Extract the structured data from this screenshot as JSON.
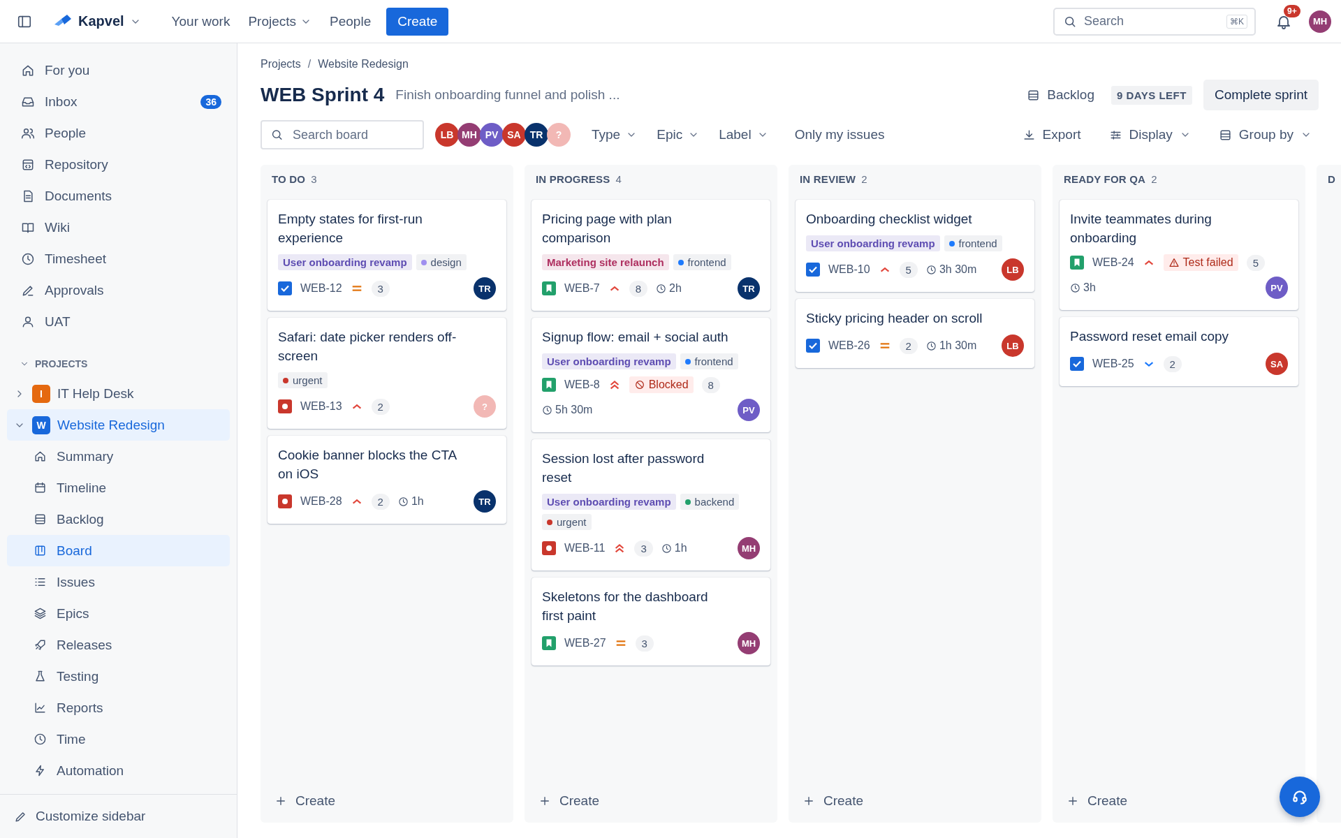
{
  "topbar": {
    "brand": "Kapvel",
    "nav": [
      {
        "label": "Your work",
        "dropdown": false
      },
      {
        "label": "Projects",
        "dropdown": true
      },
      {
        "label": "People",
        "dropdown": false
      }
    ],
    "create": "Create",
    "search": {
      "placeholder": "Search",
      "shortcut": "⌘K"
    },
    "notifications": "9+",
    "avatar": {
      "initials": "MH",
      "color": "#943d73"
    }
  },
  "sidebar": {
    "items": [
      {
        "label": "For you"
      },
      {
        "label": "Inbox",
        "badge": "36"
      },
      {
        "label": "People"
      },
      {
        "label": "Repository"
      },
      {
        "label": "Documents"
      },
      {
        "label": "Wiki"
      },
      {
        "label": "Timesheet"
      },
      {
        "label": "Approvals"
      },
      {
        "label": "UAT"
      }
    ],
    "projects_heading": "PROJECTS",
    "projects": [
      {
        "label": "IT Help Desk",
        "letter": "I",
        "color": "#e56910",
        "expanded": false,
        "selected": false
      },
      {
        "label": "Website Redesign",
        "letter": "W",
        "color": "#1868db",
        "expanded": true,
        "selected": true,
        "children": [
          {
            "label": "Summary",
            "selected": false
          },
          {
            "label": "Timeline",
            "selected": false
          },
          {
            "label": "Backlog",
            "selected": false
          },
          {
            "label": "Board",
            "selected": true
          },
          {
            "label": "Issues",
            "selected": false
          },
          {
            "label": "Epics",
            "selected": false
          },
          {
            "label": "Releases",
            "selected": false
          },
          {
            "label": "Testing",
            "selected": false
          },
          {
            "label": "Reports",
            "selected": false
          },
          {
            "label": "Time",
            "selected": false
          },
          {
            "label": "Automation",
            "selected": false
          }
        ]
      }
    ],
    "customize": "Customize sidebar"
  },
  "header": {
    "breadcrumbs": [
      "Projects",
      "Website Redesign"
    ],
    "separator": "/",
    "title": "WEB Sprint 4",
    "goal": "Finish onboarding funnel and polish ...",
    "backlog": "Backlog",
    "days_left": "9 DAYS LEFT",
    "complete": "Complete sprint"
  },
  "toolbar": {
    "search": {
      "placeholder": "Search board"
    },
    "avatars": [
      {
        "initials": "LB",
        "color": "#c9372c"
      },
      {
        "initials": "MH",
        "color": "#943d73"
      },
      {
        "initials": "PV",
        "color": "#6e5dc6"
      },
      {
        "initials": "SA",
        "color": "#c9372c"
      },
      {
        "initials": "TR",
        "color": "#09326c"
      },
      {
        "initials": "?",
        "color": "#f2b8b5"
      }
    ],
    "filters": [
      {
        "label": "Type"
      },
      {
        "label": "Epic"
      },
      {
        "label": "Label"
      }
    ],
    "only_mine": "Only my issues",
    "actions": [
      {
        "label": "Export",
        "dropdown": false
      },
      {
        "label": "Display",
        "dropdown": true
      },
      {
        "label": "Group by",
        "dropdown": true
      }
    ]
  },
  "columns": [
    {
      "name": "TO DO",
      "count": "3",
      "create": "Create",
      "cards": [
        {
          "title": "Empty states for first-run experience",
          "tags": [
            {
              "kind": "epic",
              "text": "User onboarding revamp",
              "color": "#5e4db2"
            },
            {
              "kind": "label",
              "text": "design",
              "color": "#9f8fef"
            }
          ],
          "kind": "task",
          "key": "WEB-12",
          "priority": {
            "kind": "medium"
          },
          "points": "3",
          "assignee": {
            "initials": "TR",
            "color": "#09326c"
          }
        },
        {
          "title": "Safari: date picker renders off-screen",
          "tags": [
            {
              "kind": "label",
              "text": "urgent",
              "color": "#c9372c"
            }
          ],
          "kind": "bug",
          "key": "WEB-13",
          "priority": {
            "kind": "high"
          },
          "points": "2",
          "assignee": {
            "initials": "?",
            "color": "#f2b8b5"
          }
        },
        {
          "title": "Cookie banner blocks the CTA on iOS",
          "kind": "bug",
          "key": "WEB-28",
          "priority": {
            "kind": "high"
          },
          "points": "2",
          "time": "1h",
          "assignee": {
            "initials": "TR",
            "color": "#09326c"
          }
        }
      ]
    },
    {
      "name": "IN PROGRESS",
      "count": "4",
      "create": "Create",
      "cards": [
        {
          "title": "Pricing page with plan comparison",
          "tags": [
            {
              "kind": "epic",
              "text": "Marketing site relaunch",
              "color": "#ae2e5f"
            },
            {
              "kind": "label",
              "text": "frontend",
              "color": "#1d7afc"
            }
          ],
          "kind": "story",
          "key": "WEB-7",
          "priority": {
            "kind": "high"
          },
          "points": "8",
          "time": "2h",
          "assignee": {
            "initials": "TR",
            "color": "#09326c"
          }
        },
        {
          "title": "Signup flow: email + social auth",
          "tags": [
            {
              "kind": "epic",
              "text": "User onboarding revamp",
              "color": "#5e4db2"
            },
            {
              "kind": "label",
              "text": "frontend",
              "color": "#1d7afc"
            }
          ],
          "kind": "story",
          "key": "WEB-8",
          "priority": {
            "kind": "highest"
          },
          "flag": {
            "kind": "blocked",
            "text": "Blocked"
          },
          "points": "8",
          "time": "5h 30m",
          "assignee": {
            "initials": "PV",
            "color": "#6e5dc6"
          }
        },
        {
          "title": "Session lost after password reset",
          "tags": [
            {
              "kind": "epic",
              "text": "User onboarding revamp",
              "color": "#5e4db2"
            },
            {
              "kind": "label",
              "text": "backend",
              "color": "#22a06b"
            },
            {
              "kind": "label",
              "text": "urgent",
              "color": "#c9372c"
            }
          ],
          "kind": "bug",
          "key": "WEB-11",
          "priority": {
            "kind": "highest"
          },
          "points": "3",
          "time": "1h",
          "assignee": {
            "initials": "MH",
            "color": "#943d73"
          }
        },
        {
          "title": "Skeletons for the dashboard first paint",
          "kind": "story",
          "key": "WEB-27",
          "priority": {
            "kind": "medium"
          },
          "points": "3",
          "assignee": {
            "initials": "MH",
            "color": "#943d73"
          }
        }
      ]
    },
    {
      "name": "IN REVIEW",
      "count": "2",
      "create": "Create",
      "cards": [
        {
          "title": "Onboarding checklist widget",
          "tags": [
            {
              "kind": "epic",
              "text": "User onboarding revamp",
              "color": "#5e4db2"
            },
            {
              "kind": "label",
              "text": "frontend",
              "color": "#1d7afc"
            }
          ],
          "kind": "task",
          "key": "WEB-10",
          "priority": {
            "kind": "high"
          },
          "points": "5",
          "time": "3h 30m",
          "assignee": {
            "initials": "LB",
            "color": "#c9372c"
          }
        },
        {
          "title": "Sticky pricing header on scroll",
          "kind": "task",
          "key": "WEB-26",
          "priority": {
            "kind": "medium"
          },
          "points": "2",
          "time": "1h 30m",
          "assignee": {
            "initials": "LB",
            "color": "#c9372c"
          }
        }
      ]
    },
    {
      "name": "READY FOR QA",
      "count": "2",
      "create": "Create",
      "cards": [
        {
          "title": "Invite teammates during onboarding",
          "kind": "story",
          "key": "WEB-24",
          "priority": {
            "kind": "high"
          },
          "flag": {
            "kind": "failed",
            "text": "Test failed"
          },
          "points": "5",
          "time": "3h",
          "assignee": {
            "initials": "PV",
            "color": "#6e5dc6"
          }
        },
        {
          "title": "Password reset email copy",
          "kind": "task",
          "key": "WEB-25",
          "priority": {
            "kind": "low"
          },
          "points": "2",
          "assignee": {
            "initials": "SA",
            "color": "#c9372c"
          }
        }
      ]
    },
    {
      "name": "D"
    }
  ]
}
